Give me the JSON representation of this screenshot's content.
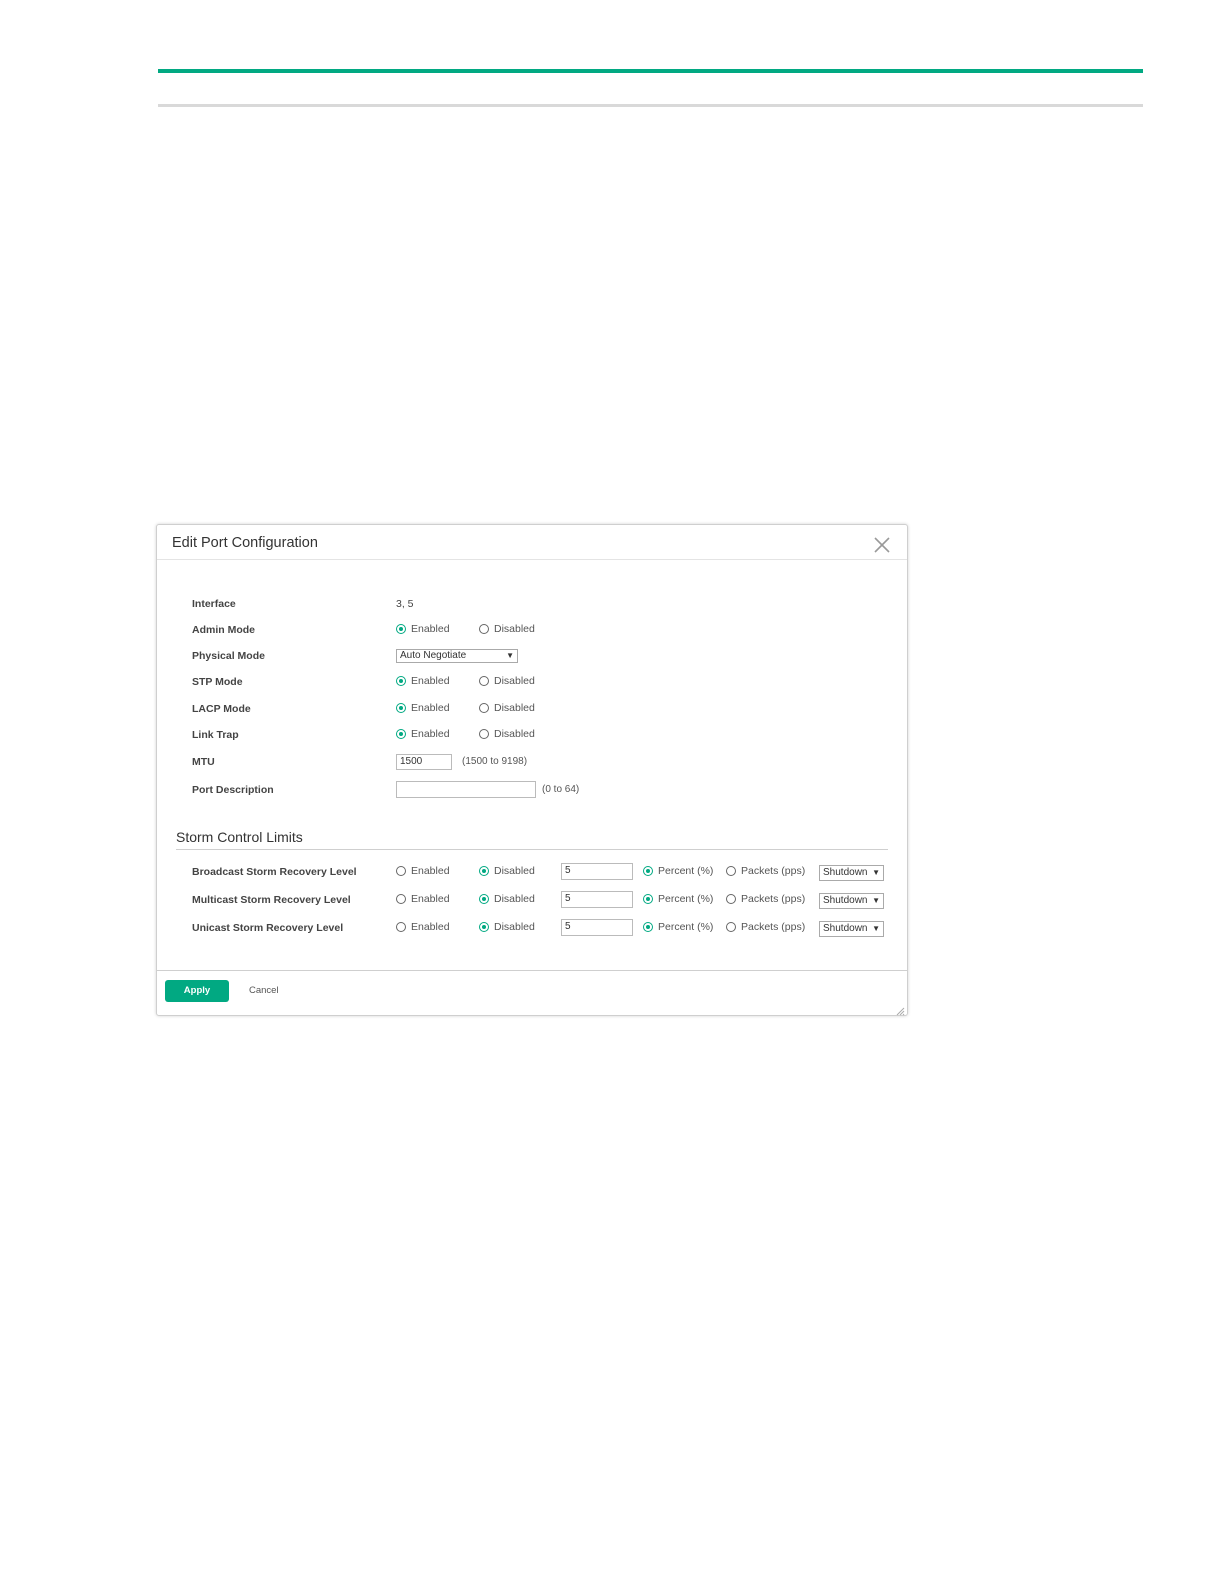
{
  "dialog": {
    "title": "Edit Port Configuration",
    "fields": {
      "interface": {
        "label": "Interface",
        "value": "3, 5"
      },
      "admin_mode": {
        "label": "Admin Mode",
        "selected": "Enabled"
      },
      "physical_mode": {
        "label": "Physical Mode",
        "value": "Auto Negotiate"
      },
      "stp_mode": {
        "label": "STP Mode",
        "selected": "Enabled"
      },
      "lacp_mode": {
        "label": "LACP Mode",
        "selected": "Enabled"
      },
      "link_trap": {
        "label": "Link Trap",
        "selected": "Enabled"
      },
      "mtu": {
        "label": "MTU",
        "value": "1500",
        "hint": "(1500 to 9198)"
      },
      "port_description": {
        "label": "Port Description",
        "value": "",
        "hint": "(0 to 64)"
      }
    },
    "options": {
      "enabled": "Enabled",
      "disabled": "Disabled"
    },
    "storm": {
      "title": "Storm Control Limits",
      "unit_percent": "Percent (%)",
      "unit_packets": "Packets (pps)",
      "rows": [
        {
          "label": "Broadcast Storm Recovery Level",
          "selected": "Disabled",
          "value": "5",
          "unit": "Percent (%)",
          "action": "Shutdown"
        },
        {
          "label": "Multicast Storm Recovery Level",
          "selected": "Disabled",
          "value": "5",
          "unit": "Percent (%)",
          "action": "Shutdown"
        },
        {
          "label": "Unicast Storm Recovery Level",
          "selected": "Disabled",
          "value": "5",
          "unit": "Percent (%)",
          "action": "Shutdown"
        }
      ]
    },
    "footer": {
      "apply": "Apply",
      "cancel": "Cancel"
    }
  },
  "colors": {
    "accent": "#01a982",
    "divider": "#d9d9d9"
  },
  "icons": {
    "close": "close-icon",
    "resize": "resize-grip-icon"
  }
}
